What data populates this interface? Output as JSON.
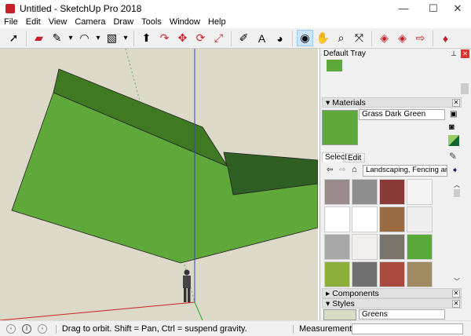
{
  "window": {
    "title": "Untitled - SketchUp Pro 2018",
    "minimize": "—",
    "maximize": "☐",
    "close": "✕"
  },
  "menu": [
    "File",
    "Edit",
    "View",
    "Camera",
    "Draw",
    "Tools",
    "Window",
    "Help"
  ],
  "toolbar": [
    {
      "icon": "select-arrow-icon",
      "glyph": "➚"
    },
    {
      "sep": true
    },
    {
      "icon": "eraser-icon",
      "glyph": "▰"
    },
    {
      "icon": "pencil-line-icon",
      "glyph": "✎"
    },
    {
      "icon": "dropdown-icon",
      "glyph": "▾"
    },
    {
      "icon": "arc-icon",
      "glyph": "◠"
    },
    {
      "icon": "dropdown-icon",
      "glyph": "▾"
    },
    {
      "icon": "rectangle-icon",
      "glyph": "▧"
    },
    {
      "icon": "dropdown-icon",
      "glyph": "▾"
    },
    {
      "sep": true
    },
    {
      "icon": "push-pull-icon",
      "glyph": "⬆"
    },
    {
      "icon": "follow-me-icon",
      "glyph": "↷"
    },
    {
      "icon": "move-icon",
      "glyph": "✥"
    },
    {
      "icon": "rotate-icon",
      "glyph": "⟳"
    },
    {
      "icon": "scale-icon",
      "glyph": "⤢"
    },
    {
      "sep": true
    },
    {
      "icon": "tape-measure-icon",
      "glyph": "✐"
    },
    {
      "icon": "text-icon",
      "glyph": "A"
    },
    {
      "icon": "paint-bucket-icon",
      "glyph": "◕"
    },
    {
      "sep": true
    },
    {
      "icon": "orbit-icon",
      "glyph": "◉",
      "active": true
    },
    {
      "icon": "pan-hand-icon",
      "glyph": "✋"
    },
    {
      "icon": "zoom-icon",
      "glyph": "⌕"
    },
    {
      "icon": "zoom-extents-icon",
      "glyph": "⤧"
    },
    {
      "sep": true
    },
    {
      "icon": "3d-warehouse-icon",
      "glyph": "◈"
    },
    {
      "icon": "extension-warehouse-icon",
      "glyph": "◈"
    },
    {
      "icon": "send-to-layout-icon",
      "glyph": "⇨"
    },
    {
      "sep": true
    },
    {
      "icon": "extension-manager-icon",
      "glyph": "♦"
    }
  ],
  "colors": {
    "accent": "#cce4f7",
    "grass": "#5fa83a",
    "grass_dark": "#3f7a23",
    "viewport_bg": "#dcd9c8"
  },
  "tray": {
    "title": "Default Tray",
    "materials": {
      "header": "Materials",
      "name": "Grass Dark Green",
      "tabs": [
        "Select",
        "Edit"
      ],
      "library": "Landscaping, Fencing and Ve",
      "swatches": [
        "#9a8a8c",
        "#8e8e8e",
        "#8a3a36",
        "#f4f4f4",
        "#ffffff",
        "#ffffff",
        "#9a6a40",
        "#eeeeee",
        "#a8a8a8",
        "#f2eeee",
        "#7a746c",
        "#5aa83a",
        "#8ab03a",
        "#707070",
        "#a84a3e",
        "#a08a60"
      ]
    },
    "components": {
      "header": "Components"
    },
    "styles": {
      "header": "Styles",
      "name": "Greens"
    }
  },
  "status": {
    "hint": "Drag to orbit. Shift = Pan, Ctrl = suspend gravity.",
    "measurements_label": "Measurements",
    "measurements_value": ""
  }
}
